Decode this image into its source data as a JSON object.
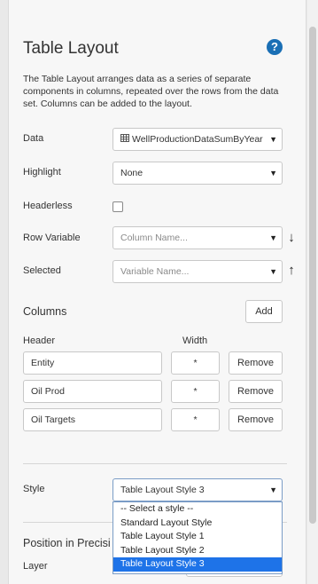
{
  "panel": {
    "title": "Table Layout",
    "help_glyph": "?",
    "description": "The Table Layout arranges data as a series of separate components in columns, repeated over the rows from the data set. Columns can be added to the layout."
  },
  "fields": {
    "data_label": "Data",
    "data_value": "WellProductionDataSumByYear",
    "data_icon": "table-icon",
    "highlight_label": "Highlight",
    "highlight_value": "None",
    "headerless_label": "Headerless",
    "row_variable_label": "Row Variable",
    "row_variable_placeholder": "Column Name...",
    "selected_label": "Selected",
    "selected_placeholder": "Variable Name..."
  },
  "columns": {
    "title": "Columns",
    "add_label": "Add",
    "header_label": "Header",
    "width_label": "Width",
    "remove_label": "Remove",
    "rows": [
      {
        "header": "Entity",
        "width": "*"
      },
      {
        "header": "Oil Prod",
        "width": "*"
      },
      {
        "header": "Oil Targets",
        "width": "*"
      }
    ]
  },
  "style": {
    "label": "Style",
    "value": "Table Layout Style 3",
    "options": [
      "-- Select a style --",
      "Standard Layout Style",
      "Table Layout Style 1",
      "Table Layout Style 2",
      "Table Layout Style 3"
    ],
    "selected_index": 4
  },
  "position": {
    "title": "Position in Precisi",
    "layer_label": "Layer"
  },
  "colors": {
    "accent": "#1a6fb5",
    "selection": "#1e73e8"
  }
}
